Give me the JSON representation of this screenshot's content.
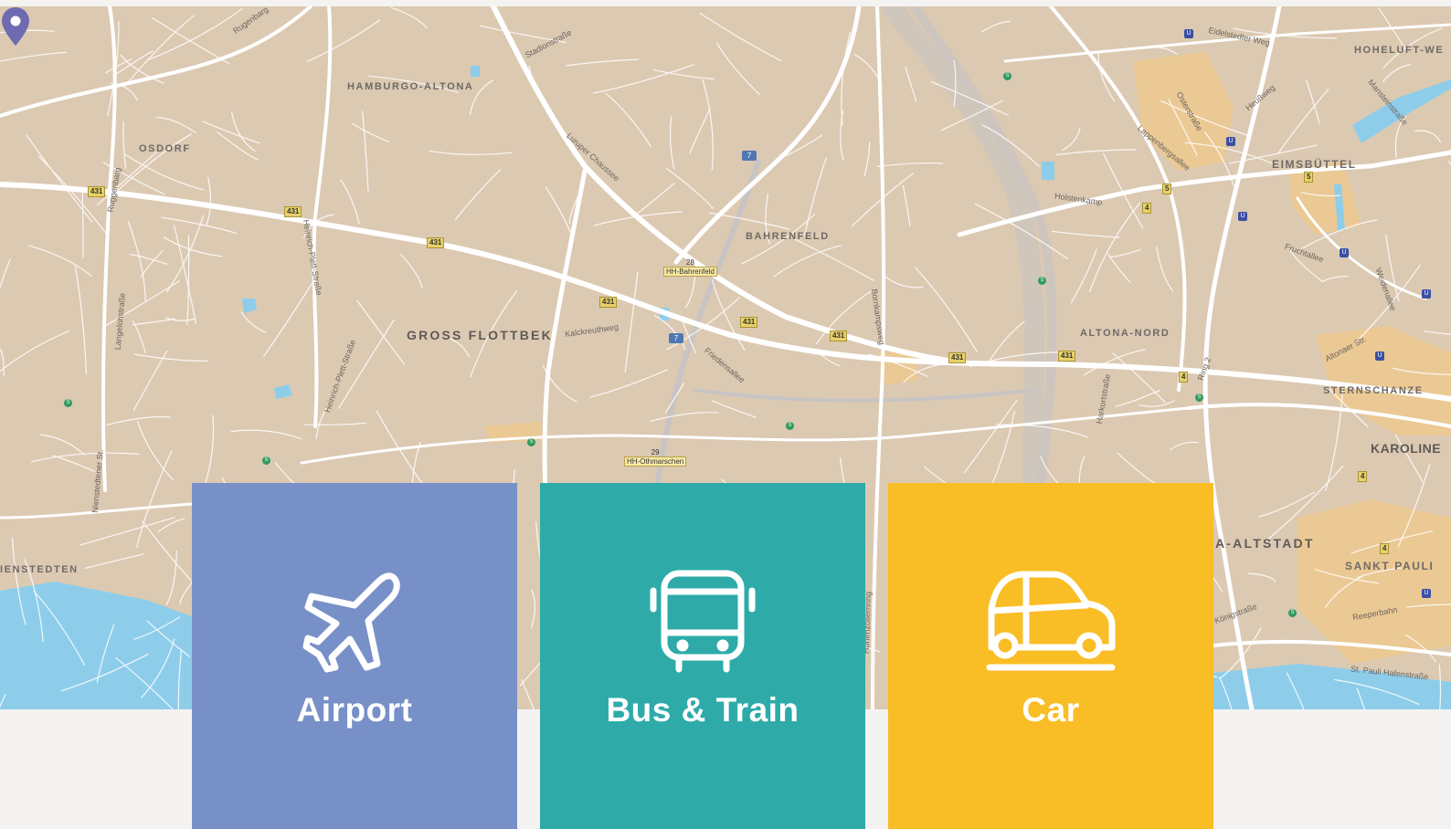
{
  "map": {
    "districts": [
      "HAMBURGO-ALTONA",
      "OSDORF",
      "GROSS FLOTTBEK",
      "BAHRENFELD",
      "ALTONA-NORD",
      "EIMSBÜTTEL",
      "HOHELUFT-WE",
      "STERNSCHANZE",
      "KAROLINE",
      "SANKT PAULI",
      "A-ALTSTADT",
      "IENSTEDTEN"
    ],
    "roads": [
      "Stadionstraße",
      "Rugenbarg",
      "Ruggenbarg",
      "Heinrich-Plett-Straße",
      "Langelohstraße",
      "Kalckreuthweg",
      "Friedensallee",
      "Holstenkamp",
      "Bornkampsweg",
      "Harkortstraße",
      "Fruchtallee",
      "Eidelstedter Weg",
      "Osterstraße",
      "Lappenbergsallee",
      "Heußweg",
      "Altonaer Str.",
      "Ring 2",
      "Königstraße",
      "Reeperbahn",
      "St. Pauli Hafenstraße",
      "Hohenzollernring",
      "Nienstedtener St.",
      "Weidenallee",
      "Mansteinstraße",
      "Luruper Chaussee",
      "Heinrich-Plett-Straße"
    ],
    "shields": [
      "431",
      "431",
      "431",
      "431",
      "431",
      "431",
      "431",
      "431",
      "4",
      "4",
      "4",
      "4",
      "5",
      "5"
    ],
    "highway_shields": [
      "7",
      "7"
    ],
    "stations": [
      {
        "num": "28",
        "name": "HH-Bahrenfeld"
      },
      {
        "num": "29",
        "name": "HH-Othmarschen"
      }
    ],
    "ubahn_glyph": "U",
    "sbahn_glyph": "S"
  },
  "transport": [
    {
      "id": "airport",
      "label": "Airport",
      "icon": "airplane-icon",
      "color": "#7890c8"
    },
    {
      "id": "bus",
      "label": "Bus & Train",
      "icon": "bus-icon",
      "color": "#2eaba9"
    },
    {
      "id": "car",
      "label": "Car",
      "icon": "car-icon",
      "color": "#f9bd25"
    }
  ],
  "colors": {
    "land": "#dcc9b2",
    "road": "#ffffff",
    "water": "#8ecdea",
    "highlight": "#f6c27a",
    "pin": "#6e6bb0",
    "page_bg": "#f4f3f1"
  }
}
